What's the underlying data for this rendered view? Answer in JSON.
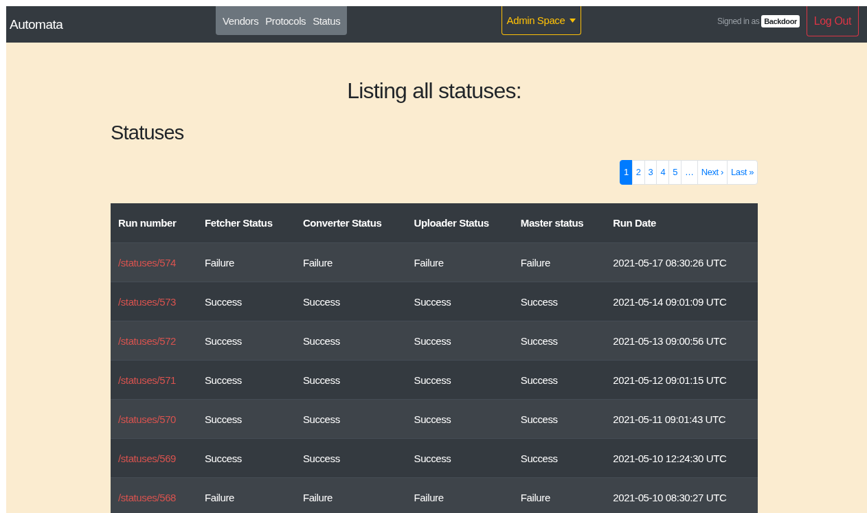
{
  "navbar": {
    "brand": "Automata",
    "links": [
      {
        "label": "Vendors"
      },
      {
        "label": "Protocols"
      },
      {
        "label": "Status"
      }
    ],
    "dropdown": "Admin Space",
    "signed_in_label": "Signed in as",
    "user": "Backdoor",
    "logout": "Log Out"
  },
  "heading": "Listing all statuses:",
  "subheading": "Statuses",
  "pagination": [
    {
      "label": "1",
      "selected": true
    },
    {
      "label": "2",
      "selected": false
    },
    {
      "label": "3",
      "selected": false
    },
    {
      "label": "4",
      "selected": false
    },
    {
      "label": "5",
      "selected": false
    },
    {
      "label": "…",
      "selected": false
    },
    {
      "label": "Next ›",
      "selected": false
    },
    {
      "label": "Last »",
      "selected": false
    }
  ],
  "table": {
    "columns": [
      "Run number",
      "Fetcher Status",
      "Converter Status",
      "Uploader Status",
      "Master status",
      "Run Date"
    ],
    "rows": [
      [
        "/statuses/574",
        "Failure",
        "Failure",
        "Failure",
        "Failure",
        "2021-05-17 08:30:26 UTC"
      ],
      [
        "/statuses/573",
        "Success",
        "Success",
        "Success",
        "Success",
        "2021-05-14 09:01:09 UTC"
      ],
      [
        "/statuses/572",
        "Success",
        "Success",
        "Success",
        "Success",
        "2021-05-13 09:00:56 UTC"
      ],
      [
        "/statuses/571",
        "Success",
        "Success",
        "Success",
        "Success",
        "2021-05-12 09:01:15 UTC"
      ],
      [
        "/statuses/570",
        "Success",
        "Success",
        "Success",
        "Success",
        "2021-05-11 09:01:43 UTC"
      ],
      [
        "/statuses/569",
        "Success",
        "Success",
        "Success",
        "Success",
        "2021-05-10 12:24:30 UTC"
      ],
      [
        "/statuses/568",
        "Failure",
        "Failure",
        "Failure",
        "Failure",
        "2021-05-10 08:30:27 UTC"
      ]
    ]
  }
}
